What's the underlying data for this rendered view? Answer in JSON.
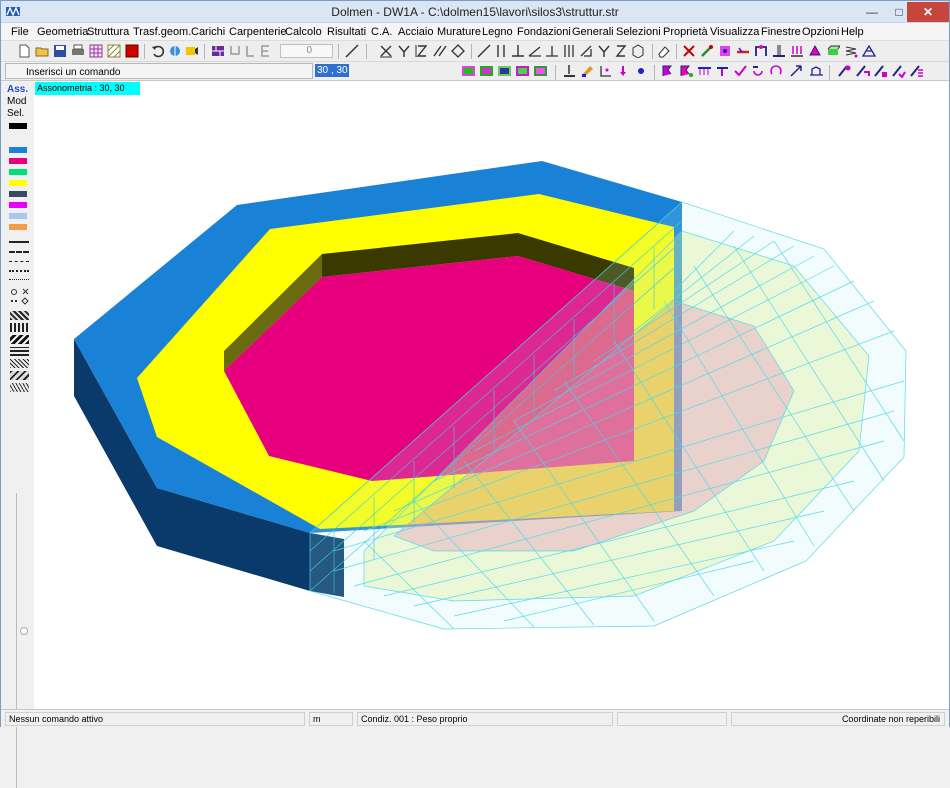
{
  "window": {
    "title": "Dolmen - DW1A - C:\\dolmen15\\lavori\\silos3\\struttur.str",
    "minimize": "—",
    "maximize": "□",
    "close": "✕"
  },
  "menu": [
    "File",
    "Geometria",
    "Struttura",
    "Trasf.geom.",
    "Carichi",
    "Carpenterie",
    "Calcolo",
    "Risultati",
    "C.A.",
    "Acciaio",
    "Murature",
    "Legno",
    "Fondazioni",
    "Generali",
    "Selezioni",
    "Proprietà",
    "Visualizza",
    "Finestre",
    "Opzioni",
    "Help"
  ],
  "toolbar": {
    "num_value": "0",
    "icons": [
      "new-file-icon",
      "open-file-icon",
      "save-icon",
      "print-icon",
      "grid-icon",
      "stop-icon",
      "undo-icon",
      "rotate-icon",
      "view-icon",
      "wall-icon",
      "line-icon",
      "x-axis-icon",
      "y-axis-icon",
      "z-axis-icon",
      "parallel-icon",
      "rhombus-icon",
      "eraser-icon"
    ]
  },
  "command": {
    "label": "Inserisci un comando",
    "coordinates": "30 , 30"
  },
  "left_panel": {
    "ass": "Ass.",
    "mod": "Mod",
    "sel": "Sel.",
    "colors": [
      "#000000",
      "#1a82d6",
      "#e6007e",
      "#00e07a",
      "#ffff00",
      "#3a4a60",
      "#e800ff",
      "#a8c8f0",
      "#f39c4a"
    ]
  },
  "viewport": {
    "view_label": "Assonometria :  30, 30",
    "colors": {
      "top_slab": "#1a82d6",
      "ring": "#ffff00",
      "inner": "#e6007e",
      "side": "#0a3a6a",
      "mesh": "#4fd8ea"
    }
  },
  "status": {
    "command": "Nessun comando attivo",
    "unit": "m",
    "condition": "Condiz. 001 : Peso proprio",
    "coordinates": "Coordinate non reperibili"
  }
}
